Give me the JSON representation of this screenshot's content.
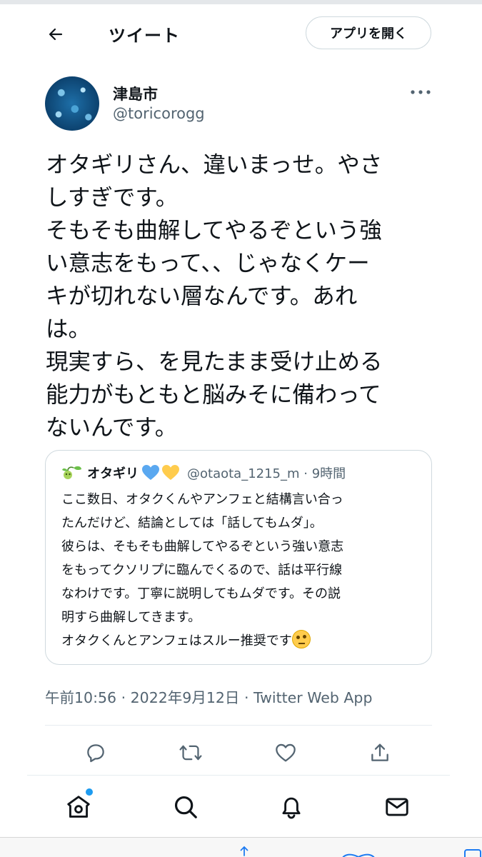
{
  "header": {
    "title": "ツイート",
    "open_app_label": "アプリを開く"
  },
  "tweet": {
    "display_name": "津島市",
    "handle": "@toricorogg",
    "text": "オタギリさん、違いまっせ。やさ\nしすぎです。\nそもそも曲解してやるぞという強\nい意志をもって、、じゃなくケー\nキが切れない層なんです。あれ\nは。\n現実すら、を見たまま受け止める\n能力がもともと脳みそに備わって\nないんです。",
    "timestamp": "午前10:56 · 2022年9月12日 · Twitter Web App"
  },
  "quote": {
    "name": "オタギリ",
    "hearts": [
      "blue-heart",
      "yellow-heart"
    ],
    "meta": "@otaota_1215_m · 9時間",
    "text": "ここ数日、オタクくんやアンフェと結構言い合っ\nたんだけど、結論としては「話してもムダ」。\n彼らは、そもそも曲解してやるぞという強い意志\nをもってクソリプに臨んでくるので、話は平行線\nなわけです。丁寧に説明してもムダです。その説\n明すら曲解してきます。\nオタクくんとアンフェはスルー推奨です",
    "emoji": "face-with-rolling-eyes"
  },
  "actions": [
    "reply-icon",
    "retweet-icon",
    "like-icon",
    "share-icon"
  ],
  "bottom_nav": {
    "items": [
      "home-icon",
      "search-icon",
      "notifications-icon",
      "messages-icon"
    ],
    "notification_dot_color": "#1d9bf0"
  },
  "colors": {
    "text": "#0f1419",
    "secondary": "#536471",
    "border": "#cfd9de",
    "accent": "#1d9bf0",
    "blue_heart": "#5aa8f0",
    "yellow_heart": "#ffcc4d"
  }
}
